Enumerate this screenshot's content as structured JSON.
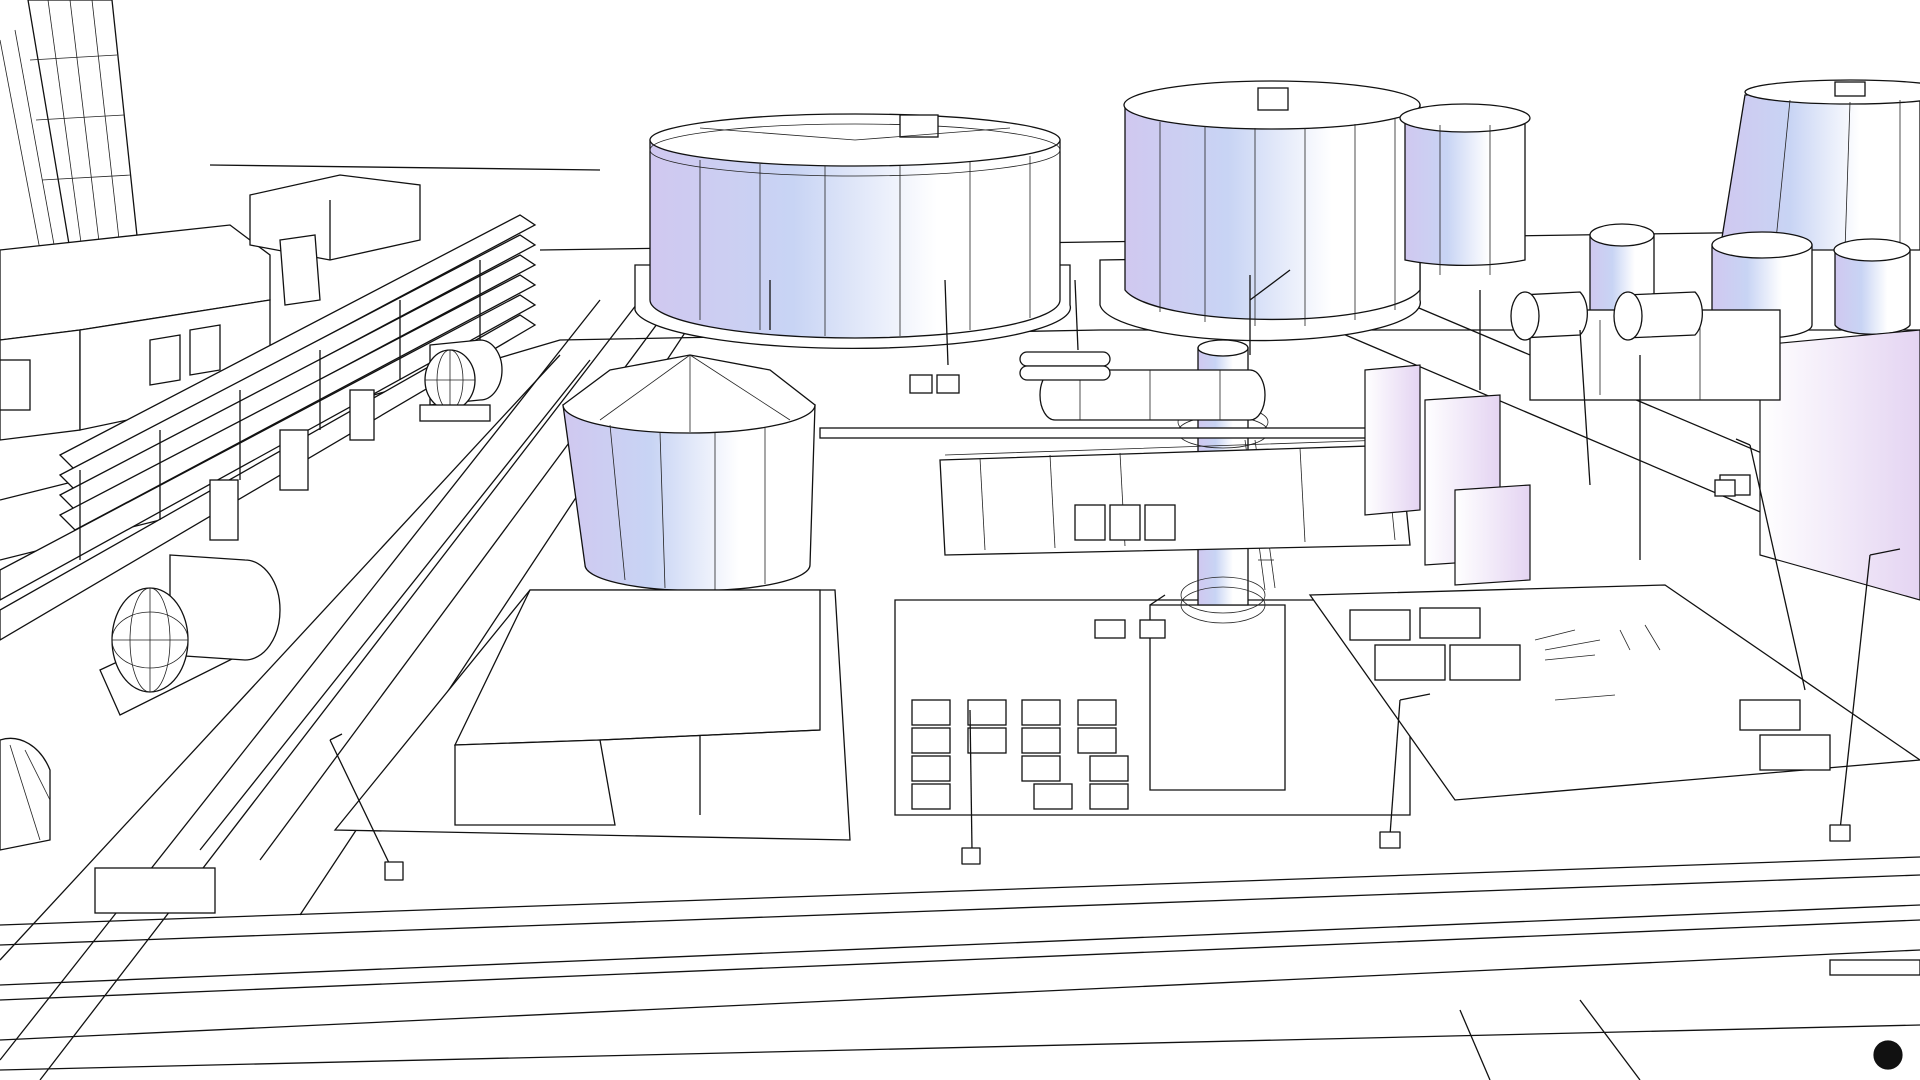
{
  "scene": {
    "kind": "industrial-plant-wireframe-render",
    "palette": {
      "background": "#ffffff",
      "line": "#111111",
      "tank_light": "#ffffff",
      "tank_tint": "#c8c8f0",
      "box_tint": "#e2d4f0"
    },
    "icons": {
      "storage_tank": "cylinder-tank-shape",
      "chimney": "smokestack-shape",
      "street_lamp": "lamp-post-shape",
      "pipe_rack": "pipe-rack-shape",
      "horizontal_tank": "capsule-tank-shape"
    }
  }
}
